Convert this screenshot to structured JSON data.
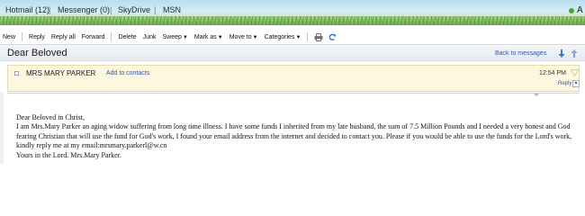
{
  "topnav": {
    "links": [
      "Hotmail (12)",
      "Messenger (0)",
      "SkyDrive",
      "MSN"
    ],
    "separator": "|",
    "corner_letter": "A"
  },
  "toolbar": {
    "new": "New",
    "reply": "Reply",
    "reply_all": "Reply all",
    "forward": "Forward",
    "delete": "Delete",
    "junk": "Junk",
    "sweep": "Sweep",
    "mark_as": "Mark as",
    "move_to": "Move to",
    "categories": "Categories",
    "caret": "▼",
    "icons": [
      "print-icon",
      "refresh-icon"
    ]
  },
  "message": {
    "subject": "Dear Beloved",
    "back_link": "Back to messages",
    "sender": "MRS MARY PARKER",
    "add_contacts": "Add to contacts",
    "time": "12:54 PM",
    "reply_label": "Reply",
    "reply_caret": "▼",
    "body_lines": [
      "Dear Beloved in Christ,",
      "I am Mrs.Mary Parker an aging widow suffering from long time illness. I have some funds I inherited from my late husband, the sum of 7.5 Million Pounds and I needed a very honest and God fearing Christian that will use the fund for God's work, I found your email address from the internet and decided to contact you. Please if you would be able to use the funds for the Lord's work, kindly reply me at my email:mrsmary.parkerl@w.cn",
      "Yours in the Lord. Mrs.Mary Parker."
    ]
  },
  "colors": {
    "link": "#2a5db0",
    "sender_panel": "#fdf7df",
    "accent_green": "#3fae2a"
  }
}
